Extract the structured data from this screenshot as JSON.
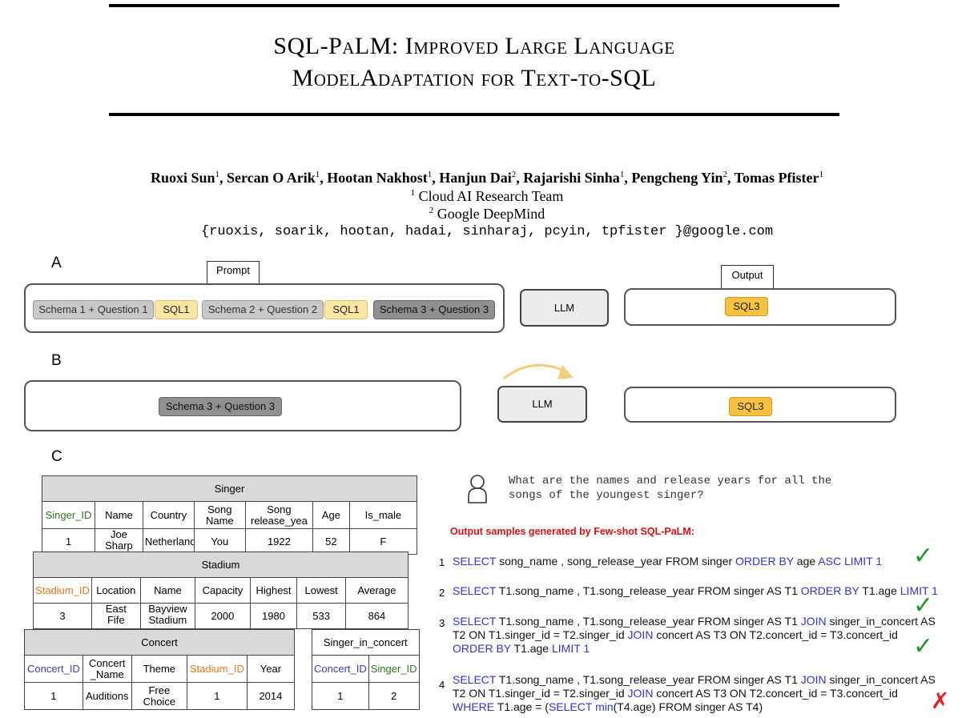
{
  "paper": {
    "title_line1": "SQL-PaLM: Improved Large Language",
    "title_line2": "ModelAdaptation for Text-to-SQL",
    "authors": [
      {
        "name": "Ruoxi Sun",
        "aff": "1"
      },
      {
        "name": "Sercan O Arik",
        "aff": "1"
      },
      {
        "name": "Hootan Nakhost",
        "aff": "1"
      },
      {
        "name": "Hanjun Dai",
        "aff": "2"
      },
      {
        "name": "Rajarishi Sinha",
        "aff": "1"
      },
      {
        "name": "Pengcheng Yin",
        "aff": "2"
      },
      {
        "name": "Tomas Pfister",
        "aff": "1"
      }
    ],
    "affiliation1_num": "1",
    "affiliation1": "Cloud AI Research Team",
    "affiliation2_num": "2",
    "affiliation2": "Google DeepMind",
    "email": "{ruoxis, soarik, hootan, hadai, sinharaj, pcyin, tpfister }@google.com"
  },
  "figure": {
    "panel_a": {
      "label": "A",
      "prompt_tag": "Prompt",
      "output_tag": "Output",
      "chips": [
        "Schema 1 + Question 1",
        "SQL1",
        "Schema 2 + Question 2",
        "SQL1",
        "Schema 3 + Question 3"
      ],
      "llm": "LLM",
      "output": "SQL3"
    },
    "panel_b": {
      "label": "B",
      "chip": "Schema 3 + Question 3",
      "llm": "LLM",
      "output": "SQL3"
    },
    "panel_c": {
      "label": "C",
      "singer": {
        "title": "Singer",
        "headers": [
          "Singer_ID",
          "Name",
          "Country",
          "Song\nName",
          "Song\nrelease_yea",
          "Age",
          "Is_male"
        ],
        "row": [
          "1",
          "Joe\nSharp",
          "Netherland",
          "You",
          "1922",
          "52",
          "F"
        ]
      },
      "stadium": {
        "title": "Stadium",
        "headers": [
          "Stadium_ID",
          "Location",
          "Name",
          "Capacity",
          "Highest",
          "Lowest",
          "Average"
        ],
        "row": [
          "3",
          "East\nFife",
          "Bayview\nStadium",
          "2000",
          "1980",
          "533",
          "864"
        ]
      },
      "concert": {
        "title": "Concert",
        "headers": [
          "Concert_ID",
          "Concert\n_Name",
          "Theme",
          "Stadium_ID",
          "Year"
        ],
        "row": [
          "1",
          "Auditions",
          "Free\nChoice",
          "1",
          "2014"
        ]
      },
      "singer_in_concert": {
        "title": "Singer_in_concert",
        "headers": [
          "Concert_ID",
          "Singer_ID"
        ],
        "row": [
          "1",
          "2"
        ]
      },
      "question_line1": "What are the names and release years for all the",
      "question_line2": "songs of the youngest singer?",
      "samples_heading": "Output samples generated by Few-shot SQL-PaLM:",
      "samples": [
        {
          "num": "1",
          "verdict": "correct"
        },
        {
          "num": "2",
          "verdict": "correct"
        },
        {
          "num": "3",
          "verdict": "correct"
        },
        {
          "num": "4",
          "verdict": "incorrect"
        }
      ],
      "s1": [
        "SELECT",
        " song_name , song_release_year FROM singer ",
        "ORDER BY",
        " age ",
        "ASC LIMIT 1"
      ],
      "s2": [
        "SELECT",
        " T1.song_name , T1.song_release_year FROM singer AS T1 ",
        "ORDER BY",
        " T1.age ",
        "LIMIT 1"
      ],
      "s3a": [
        "SELECT",
        " T1.song_name , T1.song_release_year FROM singer AS T1 ",
        "JOIN",
        " singer_in_concert AS"
      ],
      "s3b": [
        "T2 ON T1.singer_id = T2.singer_id ",
        "JOIN",
        " concert AS T3 ON T2.concert_id = T3.concert_id"
      ],
      "s3c": [
        "ORDER BY",
        " T1.age ",
        "LIMIT 1"
      ],
      "s4a": [
        "SELECT",
        " T1.song_name , T1.song_release_year FROM singer AS T1 ",
        "JOIN",
        " singer_in_concert AS"
      ],
      "s4b": [
        "T2 ON T1.singer_id = T2.singer_id ",
        "JOIN",
        " concert AS T3 ON T2.concert_id = T3.concert_id"
      ],
      "s4c": [
        "WHERE",
        " T1.age = (",
        "SELECT",
        " ",
        "min",
        "(T4.age) FROM singer AS T4)"
      ]
    }
  }
}
